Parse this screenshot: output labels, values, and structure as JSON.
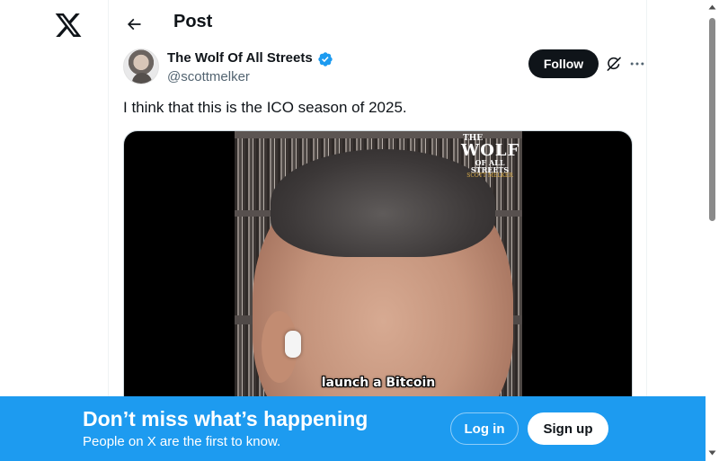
{
  "header": {
    "title": "Post"
  },
  "post": {
    "author_name": "The Wolf Of All Streets",
    "handle": "@scottmelker",
    "follow_label": "Follow",
    "text": "I think that this is the ICO season of 2025.",
    "media": {
      "watermark_line1": "THE",
      "watermark_line2": "WOLF",
      "watermark_line3": "OF ALL STREETS",
      "watermark_line4": "SCOTT MELKER",
      "caption": "launch a Bitcoin"
    }
  },
  "banner": {
    "title": "Don’t miss what’s happening",
    "subtitle": "People on X are the first to know.",
    "login_label": "Log in",
    "signup_label": "Sign up"
  },
  "colors": {
    "accent": "#1d9bf0",
    "text_primary": "#0f1419",
    "text_secondary": "#536471",
    "follow_bg": "#0f1419"
  },
  "icons": {
    "logo": "x-logo-icon",
    "back": "arrow-left-icon",
    "verified": "verified-badge-icon",
    "grok": "grok-icon",
    "more": "more-horizontal-icon"
  }
}
